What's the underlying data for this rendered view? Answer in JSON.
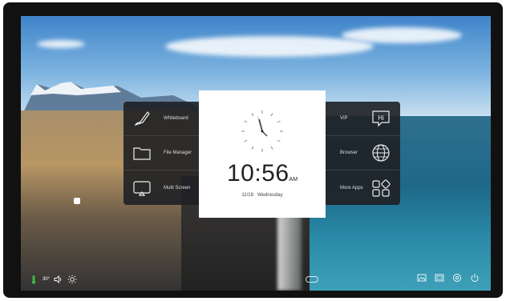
{
  "left_panel": {
    "items": [
      {
        "label": "Whiteboard",
        "icon": "pen-icon"
      },
      {
        "label": "File Manager",
        "icon": "folder-icon"
      },
      {
        "label": "Multi Screen",
        "icon": "cast-screen-icon"
      }
    ]
  },
  "right_panel": {
    "items": [
      {
        "label": "VIP",
        "icon": "hi-chat-icon",
        "icon_text": "Hi"
      },
      {
        "label": "Browser",
        "icon": "globe-icon"
      },
      {
        "label": "More Apps",
        "icon": "apps-grid-icon"
      }
    ]
  },
  "clock": {
    "time": "10:56",
    "period": "AM",
    "date": "11/18",
    "weekday": "Wednesday"
  },
  "status_bar": {
    "temperature": "30°",
    "icons_left": [
      "thermometer-icon",
      "volume-icon",
      "brightness-icon"
    ],
    "icons_right": [
      "wallpaper-icon",
      "screenshot-icon",
      "settings-icon",
      "power-icon"
    ]
  },
  "colors": {
    "panel": "#1e2024",
    "clock_card": "#ffffff",
    "accent_green": "#3fb83f"
  }
}
